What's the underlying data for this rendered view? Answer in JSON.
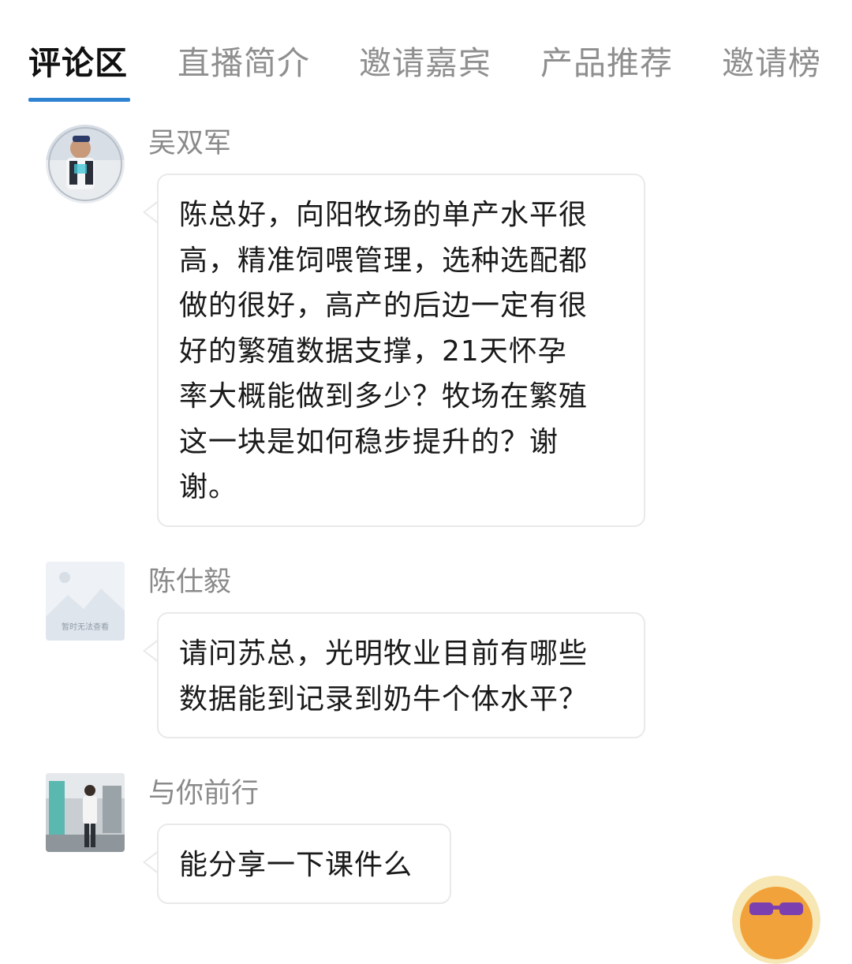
{
  "tabs": [
    {
      "label": "评论区",
      "active": true
    },
    {
      "label": "直播简介",
      "active": false
    },
    {
      "label": "邀请嘉宾",
      "active": false
    },
    {
      "label": "产品推荐",
      "active": false
    },
    {
      "label": "邀请榜",
      "active": false
    }
  ],
  "comments": [
    {
      "username": "吴双军",
      "avatar_icon": "user-photo-avatar",
      "lines": [
        "陈总好，向阳牧场的单产水平很",
        "高，精准饲喂管理，选种选配都",
        "做的很好，高产的后边一定有很",
        "好的繁殖数据支撑，21天怀孕",
        "率大概能做到多少？牧场在繁殖",
        "这一块是如何稳步提升的？谢",
        "谢。"
      ]
    },
    {
      "username": "陈仕毅",
      "avatar_icon": "image-placeholder-avatar",
      "avatar_caption": "暂时无法查看",
      "lines": [
        "请问苏总，光明牧业目前有哪些",
        "数据能到记录到奶牛个体水平？"
      ]
    },
    {
      "username": "与你前行",
      "avatar_icon": "user-photo-avatar",
      "lines": [
        "能分享一下课件么"
      ]
    }
  ],
  "floating_button_icon": "sunglasses-emoji-icon",
  "colors": {
    "accent": "#2d82d2",
    "active_tab": "#111111",
    "inactive_tab": "#8f8f8f",
    "username": "#8a8a8a",
    "bubble_border": "#e9e9e9"
  }
}
